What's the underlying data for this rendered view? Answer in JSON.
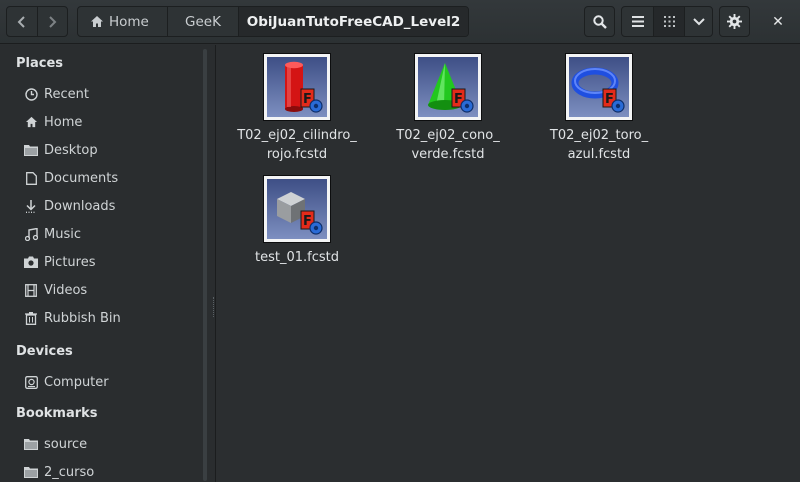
{
  "header": {
    "back_icon": "chevron-left-icon",
    "forward_icon": "chevron-right-icon",
    "breadcrumbs": [
      {
        "label": "Home",
        "icon": "home-icon"
      },
      {
        "label": "GeeK"
      },
      {
        "label": "ObiJuanTutoFreeCAD_Level2"
      }
    ],
    "search_icon": "search-icon",
    "view_icons": [
      "list-view-icon",
      "grid-view-icon",
      "chevron-down-icon"
    ],
    "settings_icon": "gear-icon",
    "close_label": "✕"
  },
  "sidebar": {
    "places_title": "Places",
    "places": [
      {
        "label": "Recent",
        "icon": "clock-icon"
      },
      {
        "label": "Home",
        "icon": "home-icon"
      },
      {
        "label": "Desktop",
        "icon": "folder-icon"
      },
      {
        "label": "Documents",
        "icon": "document-icon"
      },
      {
        "label": "Downloads",
        "icon": "download-icon"
      },
      {
        "label": "Music",
        "icon": "music-icon"
      },
      {
        "label": "Pictures",
        "icon": "camera-icon"
      },
      {
        "label": "Videos",
        "icon": "film-icon"
      },
      {
        "label": "Rubbish Bin",
        "icon": "trash-icon"
      }
    ],
    "devices_title": "Devices",
    "devices": [
      {
        "label": "Computer",
        "icon": "drive-icon"
      }
    ],
    "bookmarks_title": "Bookmarks",
    "bookmarks": [
      {
        "label": "source",
        "icon": "folder-icon"
      },
      {
        "label": "2_curso",
        "icon": "folder-icon"
      }
    ]
  },
  "files": [
    {
      "name": "T02_ej02_cilindro_\nrojo.fcstd",
      "icon": "freecad-cylinder-icon",
      "color": "#d41414"
    },
    {
      "name": "T02_ej02_cono_\nverde.fcstd",
      "icon": "freecad-cone-icon",
      "color": "#22c81e"
    },
    {
      "name": "T02_ej02_toro_\nazul.fcstd",
      "icon": "freecad-torus-icon",
      "color": "#1f4fe0"
    },
    {
      "name": "test_01.fcstd",
      "icon": "freecad-box-icon",
      "color": "#9a9da0"
    }
  ],
  "colors": {
    "background": "#2b2e30",
    "sidebar": "#2a2d2f",
    "header": "#33383b",
    "freecad_brand": "#e32b1a"
  }
}
